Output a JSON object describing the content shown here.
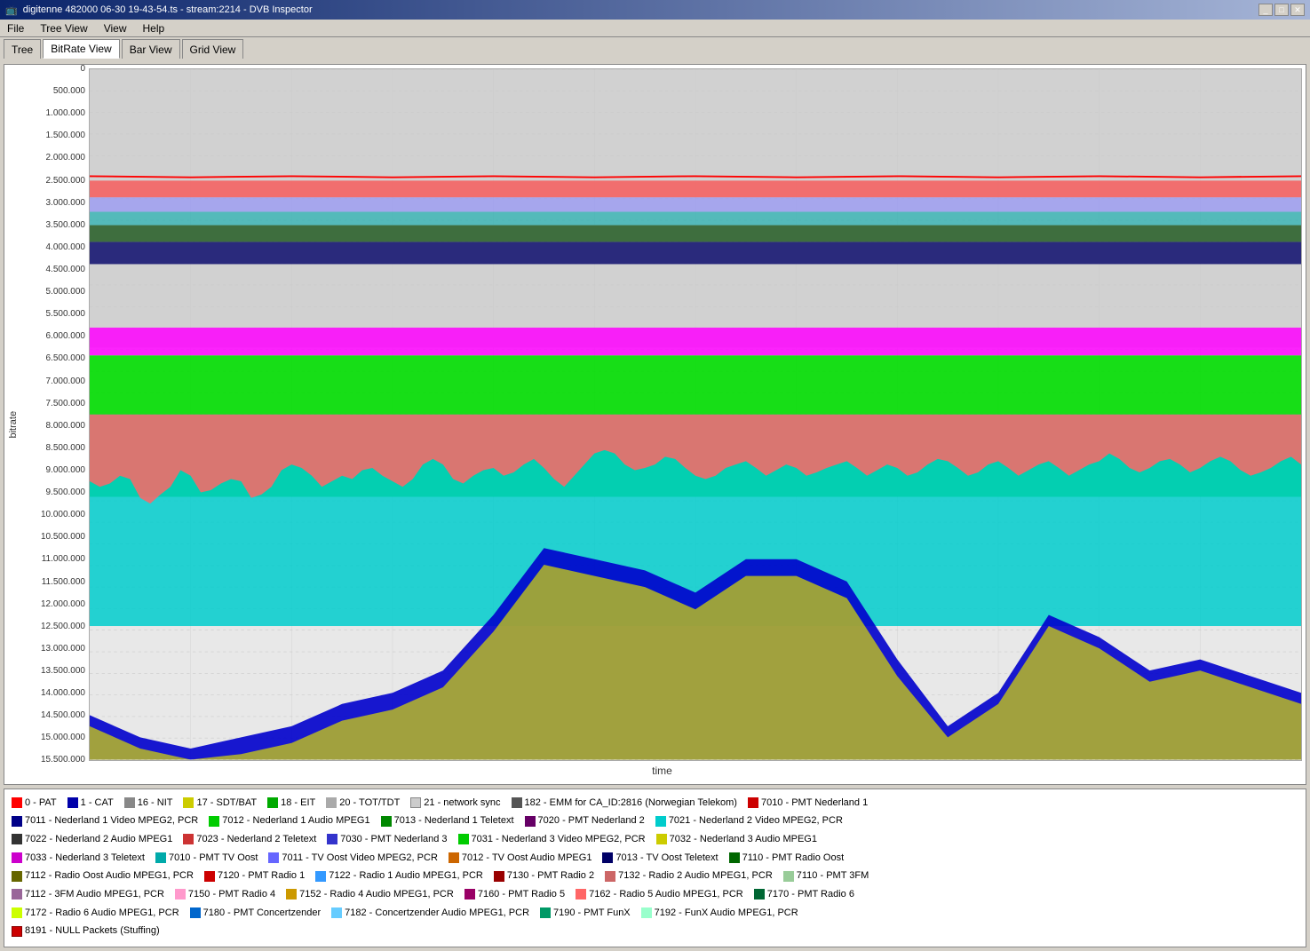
{
  "window": {
    "title": "digitenne 482000 06-30 19-43-54.ts - stream:2214 - DVB Inspector",
    "icon": "tv-icon"
  },
  "menu": {
    "items": [
      "File",
      "Tree View",
      "View",
      "Help"
    ]
  },
  "toolbar": {
    "tabs": [
      {
        "label": "Tree",
        "active": false
      },
      {
        "label": "BitRate View",
        "active": true
      },
      {
        "label": "Bar View",
        "active": false
      },
      {
        "label": "Grid View",
        "active": false
      }
    ]
  },
  "chart": {
    "y_axis_label": "bitrate",
    "x_axis_label": "time",
    "y_ticks": [
      "15.500.000",
      "15.000.000",
      "14.500.000",
      "14.000.000",
      "13.500.000",
      "13.000.000",
      "12.500.000",
      "12.000.000",
      "11.500.000",
      "11.000.000",
      "10.500.000",
      "10.000.000",
      "9.500.000",
      "9.000.000",
      "8.500.000",
      "8.000.000",
      "7.500.000",
      "7.000.000",
      "6.500.000",
      "6.000.000",
      "5.500.000",
      "5.000.000",
      "4.500.000",
      "4.000.000",
      "3.500.000",
      "3.000.000",
      "2.500.000",
      "2.000.000",
      "1.500.000",
      "1.000.000",
      "500.000",
      "0"
    ]
  },
  "legend": {
    "items": [
      {
        "color": "#ff0000",
        "label": "0 - PAT"
      },
      {
        "color": "#0000aa",
        "label": "1 - CAT"
      },
      {
        "color": "#888888",
        "label": "16 - NIT"
      },
      {
        "color": "#ffff00",
        "label": "17 - SDT/BAT"
      },
      {
        "color": "#00aa00",
        "label": "18 - EIT"
      },
      {
        "color": "#888888",
        "label": "20 - TOT/TDT"
      },
      {
        "color": "#aaaaaa",
        "label": "21 - network sync"
      },
      {
        "color": "#555555",
        "label": "182 - EMM for CA_ID:2816 (Norwegian Telekom)"
      },
      {
        "color": "#cc0000",
        "label": "7010 - PMT Nederland 1"
      },
      {
        "color": "#000088",
        "label": "7011 - Nederland 1 Video MPEG2, PCR"
      },
      {
        "color": "#00cc00",
        "label": "7012 - Nederland 1 Audio MPEG1"
      },
      {
        "color": "#008800",
        "label": "7013 - Nederland 1 Teletext"
      },
      {
        "color": "#660066",
        "label": "7020 - PMT Nederland 2"
      },
      {
        "color": "#00cccc",
        "label": "7021 - Nederland 2 Video MPEG2, PCR"
      },
      {
        "color": "#333333",
        "label": "7022 - Nederland 2 Audio MPEG1"
      },
      {
        "color": "#cc3333",
        "label": "7023 - Nederland 2 Teletext"
      },
      {
        "color": "#3333cc",
        "label": "7030 - PMT Nederland 3"
      },
      {
        "color": "#00cc00",
        "label": "7031 - Nederland 3 Video MPEG2, PCR"
      },
      {
        "color": "#cccc00",
        "label": "7032 - Nederland 3 Audio MPEG1"
      },
      {
        "color": "#cc00cc",
        "label": "7033 - Nederland 3 Teletext"
      },
      {
        "color": "#00aaaa",
        "label": "7010 - PMT TV Oost"
      },
      {
        "color": "#6666ff",
        "label": "7011 - TV Oost Video MPEG2, PCR"
      },
      {
        "color": "#cc6600",
        "label": "7012 - TV Oost Audio MPEG1"
      },
      {
        "color": "#000066",
        "label": "7013 - TV Oost Teletext"
      },
      {
        "color": "#006600",
        "label": "7110 - PMT Radio Oost"
      },
      {
        "color": "#666600",
        "label": "7112 - Radio Oost Audio MPEG1, PCR"
      },
      {
        "color": "#cc0000",
        "label": "7120 - PMT Radio 1"
      },
      {
        "color": "#3399ff",
        "label": "7122 - Radio 1 Audio MPEG1, PCR"
      },
      {
        "color": "#990000",
        "label": "7130 - PMT Radio 2"
      },
      {
        "color": "#cc6666",
        "label": "7132 - Radio 2 Audio MPEG1, PCR"
      },
      {
        "color": "#99cc99",
        "label": "7110 - PMT 3FM"
      },
      {
        "color": "#996699",
        "label": "7112 - 3FM Audio MPEG1, PCR"
      },
      {
        "color": "#ff99cc",
        "label": "7150 - PMT Radio 4"
      },
      {
        "color": "#cc9900",
        "label": "7152 - Radio 4 Audio MPEG1, PCR"
      },
      {
        "color": "#990066",
        "label": "7160 - PMT Radio 5"
      },
      {
        "color": "#ff6666",
        "label": "7162 - Radio 5 Audio MPEG1, PCR"
      },
      {
        "color": "#006633",
        "label": "7170 - PMT Radio 6"
      },
      {
        "color": "#ccff00",
        "label": "7172 - Radio 6 Audio MPEG1, PCR"
      },
      {
        "color": "#0066cc",
        "label": "7180 - PMT Concertzender"
      },
      {
        "color": "#66ccff",
        "label": "7182 - Concertzender Audio MPEG1, PCR"
      },
      {
        "color": "#009966",
        "label": "7190 - PMT FunX"
      },
      {
        "color": "#99ffcc",
        "label": "7192 - FunX Audio MPEG1, PCR"
      },
      {
        "color": "#cc0000",
        "label": "8191 - NULL Packets (Stuffing)"
      }
    ]
  }
}
